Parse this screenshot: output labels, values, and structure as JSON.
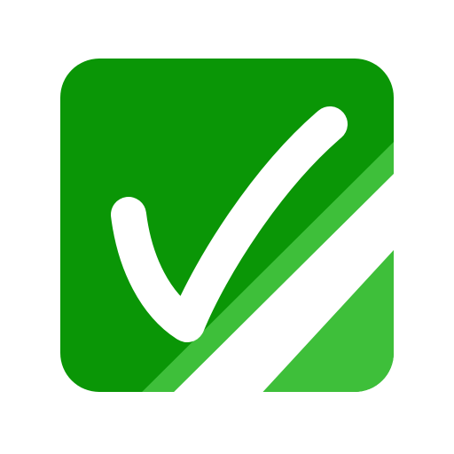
{
  "icon": {
    "name": "checkbox-checked-icon",
    "colors": {
      "background": "#ffffff",
      "tile": "#0a9606",
      "stripe_light": "#3ebf3a",
      "stripe_white": "#ffffff",
      "check": "#ffffff"
    }
  }
}
